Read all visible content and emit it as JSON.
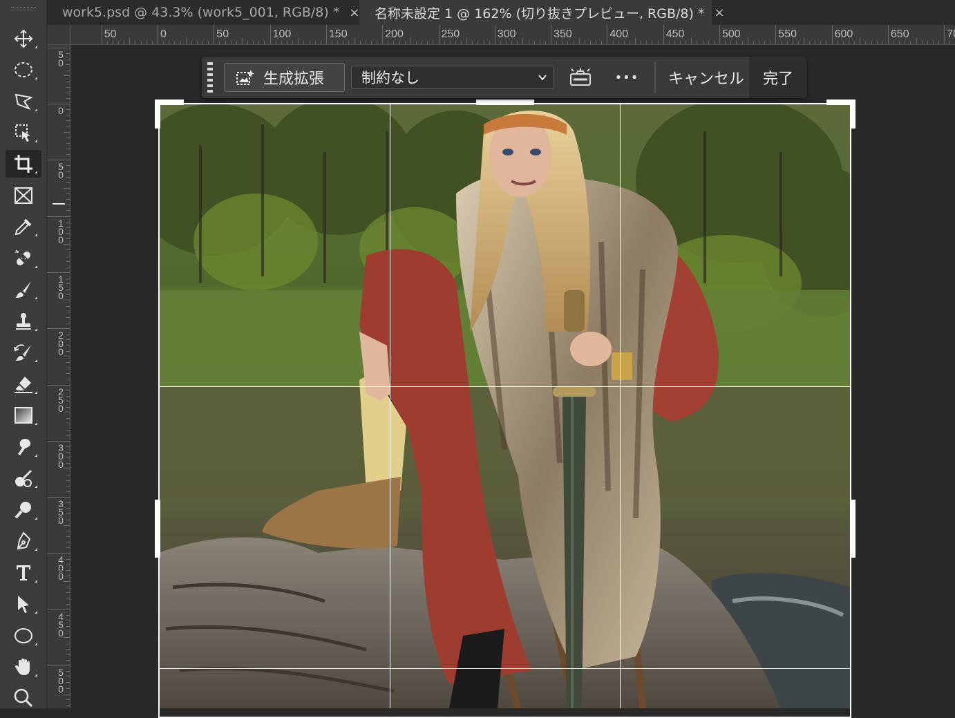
{
  "tabs": [
    {
      "label": "work5.psd @ 43.3% (work5_001, RGB/8) *",
      "close": "×",
      "active": false
    },
    {
      "label": "名称未設定 1 @ 162% (切り抜きプレビュー, RGB/8) *",
      "close": "×",
      "active": true
    }
  ],
  "ruler_top": {
    "labels": [
      "50",
      "0",
      "50",
      "100",
      "150",
      "200",
      "250",
      "300",
      "350",
      "400",
      "450",
      "500",
      "550",
      "600",
      "650",
      "70"
    ]
  },
  "ruler_left": {
    "labels": [
      "50",
      "0",
      "50",
      "100",
      "150",
      "200",
      "250",
      "300",
      "350",
      "400",
      "450",
      "500"
    ]
  },
  "toolbar": {
    "tools": [
      {
        "name": "move-tool",
        "icon": "move-icon",
        "active": false
      },
      {
        "name": "elliptical-marquee-tool",
        "icon": "ellipse-marquee-icon",
        "active": false
      },
      {
        "name": "lasso-tool",
        "icon": "polygonal-lasso-icon",
        "active": false
      },
      {
        "name": "object-selection-tool",
        "icon": "object-selection-icon",
        "active": false
      },
      {
        "name": "crop-tool",
        "icon": "crop-icon",
        "active": true
      },
      {
        "name": "frame-tool",
        "icon": "frame-icon",
        "active": false
      },
      {
        "name": "eyedropper-tool",
        "icon": "eyedropper-icon",
        "active": false
      },
      {
        "name": "spot-healing-tool",
        "icon": "bandage-icon",
        "active": false
      },
      {
        "name": "brush-tool",
        "icon": "brush-icon",
        "active": false
      },
      {
        "name": "clone-stamp-tool",
        "icon": "stamp-icon",
        "active": false
      },
      {
        "name": "history-brush-tool",
        "icon": "history-brush-icon",
        "active": false
      },
      {
        "name": "eraser-tool",
        "icon": "eraser-icon",
        "active": false
      },
      {
        "name": "gradient-tool",
        "icon": "gradient-icon",
        "active": false
      },
      {
        "name": "smudge-tool",
        "icon": "smudge-icon",
        "active": false
      },
      {
        "name": "dodge-tool",
        "icon": "dodge-icon",
        "active": false
      },
      {
        "name": "zoom-lens-tool",
        "icon": "lens-icon",
        "active": false
      },
      {
        "name": "pen-tool",
        "icon": "pen-icon",
        "active": false
      },
      {
        "name": "type-tool",
        "icon": "type-icon",
        "active": false
      },
      {
        "name": "path-selection-tool",
        "icon": "arrow-icon",
        "active": false
      },
      {
        "name": "ellipse-tool",
        "icon": "ellipse-icon",
        "active": false
      },
      {
        "name": "hand-tool",
        "icon": "hand-icon",
        "active": false
      },
      {
        "name": "zoom-tool",
        "icon": "magnifier-icon",
        "active": false
      }
    ]
  },
  "taskbar": {
    "generative_expand_label": "生成拡張",
    "aspect_select_value": "制約なし",
    "cancel_label": "キャンセル",
    "done_label": "完了",
    "more_label": "•••"
  },
  "colors": {
    "accent_white": "#ffffff",
    "panel": "#3a3a3a",
    "background": "#282828"
  }
}
